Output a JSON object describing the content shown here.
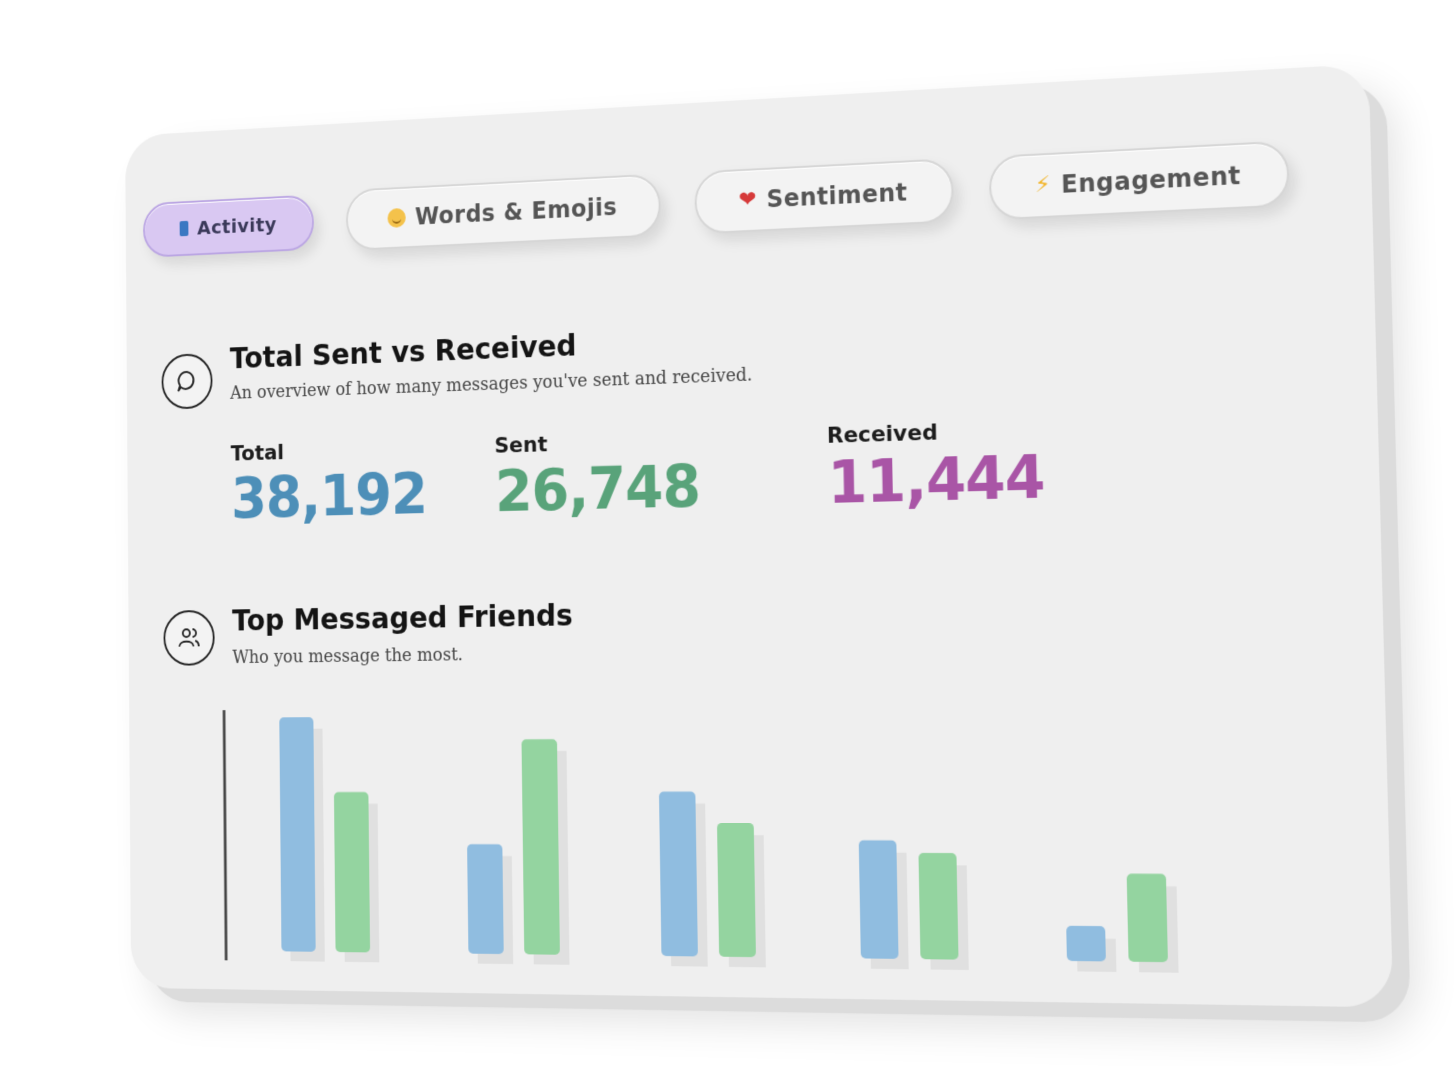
{
  "tabs": [
    {
      "label": "Activity",
      "icon": "phone-icon",
      "active": true
    },
    {
      "label": "Words & Emojis",
      "icon": "smiley-icon",
      "active": false
    },
    {
      "label": "Sentiment",
      "icon": "heart-icon",
      "active": false
    },
    {
      "label": "Engagement",
      "icon": "lightning-icon",
      "active": false
    }
  ],
  "sent_received": {
    "title": "Total Sent vs Received",
    "subtitle": "An overview of how many messages you've sent and received.",
    "icon": "chat-bubble-icon",
    "total_label": "Total",
    "total_value": "38,192",
    "sent_label": "Sent",
    "sent_value": "26,748",
    "received_label": "Received",
    "received_value": "11,444"
  },
  "top_friends": {
    "title": "Top Messaged Friends",
    "subtitle": "Who you message the most.",
    "icon": "users-icon"
  },
  "colors": {
    "series_a": "#90bde0",
    "series_b": "#94d4a0",
    "active_tab": "#d9c8f2"
  },
  "chart_data": {
    "type": "bar",
    "categories": [
      "",
      "",
      "",
      "",
      ""
    ],
    "series": [
      {
        "values": [
          100,
          46,
          68,
          48,
          14
        ]
      },
      {
        "values": [
          68,
          90,
          55,
          43,
          35
        ]
      }
    ],
    "ylim": [
      0,
      100
    ]
  }
}
